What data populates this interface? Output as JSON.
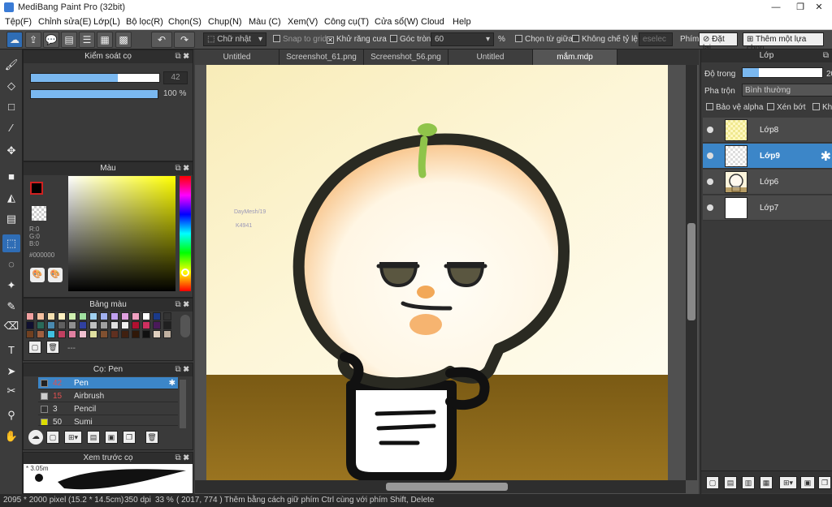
{
  "window": {
    "title": "MediBang Paint Pro (32bit)",
    "minimize": "—",
    "maximize": "❐",
    "close": "✕"
  },
  "menu": [
    "Tệp(F)",
    "Chỉnh sửa(E)",
    "Lớp(L)",
    "Bộ lọc(R)",
    "Chọn(S)",
    "Chụp(N)",
    "Màu (C)",
    "Xem(V)",
    "Công cụ(T)",
    "Cửa sổ(W)",
    "Cloud",
    "Help"
  ],
  "toolbar": {
    "shape": "Chữ nhật",
    "snap": "Snap to grid",
    "antialias": "Khử răng cưa",
    "round": "Góc tròn",
    "round_value": "60",
    "percent": "%",
    "center": "Chọn từ giữa",
    "ratio": "Không chế tỷ lệ",
    "deselect": "eselec",
    "key": "Phím",
    "reset": "Đặt lại",
    "add_selection": "Thêm một lựa chọn"
  },
  "brush_control": {
    "title": "Kiểm soát cọ",
    "size": "42",
    "opacity": "100 %",
    "size_fraction": 0.68,
    "opacity_fraction": 1.0
  },
  "color": {
    "title": "Màu",
    "r": "R:0",
    "g": "G:0",
    "b": "B:0",
    "hex": "#000000",
    "primary": "#000000",
    "hue_base": "#ffff00"
  },
  "palette": {
    "title": "Bảng màu",
    "colors": [
      "#f2a0a0",
      "#f5c0a0",
      "#f5e0b0",
      "#fff0c0",
      "#d0f0b0",
      "#a0e0a0",
      "#a0d0f0",
      "#a0b0f0",
      "#c0a0f0",
      "#e0a0e0",
      "#f0a0c0",
      "#ffffff",
      "#1a3a8a",
      "#333333",
      "#101030",
      "#2a6a5a",
      "#4a8ab0",
      "#606060",
      "#909090",
      "#3040a0",
      "#c0c0c0",
      "#a0a0a0",
      "#e0e0e0",
      "#f0f0f0",
      "#b01030",
      "#d03060",
      "#4a1a5a",
      "#202020",
      "#704020",
      "#a06040",
      "#40c0e0",
      "#c04060",
      "#e080a0",
      "#f0c0d0",
      "#e0e0a0",
      "#805030",
      "#603020",
      "#402010",
      "#301808",
      "#101010",
      "#e0d0c0",
      "#c0b0a0"
    ],
    "footer": "---"
  },
  "brushes": {
    "title": "Cọ: Pen",
    "items": [
      {
        "num": "42",
        "name": "Pen",
        "color": "#222222"
      },
      {
        "num": "15",
        "name": "Airbrush",
        "color": "#cccccc"
      },
      {
        "num": "3",
        "name": "Pencil",
        "color": "#333333"
      },
      {
        "num": "50",
        "name": "Sumi",
        "color": "#dddd00"
      }
    ]
  },
  "preview": {
    "title": "Xem trước cọ",
    "size": "* 3.05m"
  },
  "tabs": [
    "Untitled",
    "Screenshot_61.png",
    "Screenshot_56.png",
    "Untitled",
    "mắm.mdp"
  ],
  "layers_panel": {
    "title": "Lớp",
    "opacity_label": "Độ trong",
    "opacity_value": "20",
    "opacity_fraction": 0.2,
    "blend_label": "Pha trộn",
    "blend_value": "Bình thường",
    "protect_alpha": "Bảo vệ alpha",
    "clipping": "Xén bớt",
    "lock": "Khó",
    "layers": [
      {
        "name": "Lớp8",
        "selected": false
      },
      {
        "name": "Lớp9",
        "selected": true
      },
      {
        "name": "Lớp6",
        "selected": false
      },
      {
        "name": "Lớp7",
        "selected": false
      }
    ]
  },
  "canvas_text": {
    "signature_line1": "DayMesh/19",
    "signature_line2": "K4941"
  },
  "status": {
    "size": "2095 * 2000 pixel",
    "cm": "(15.2 * 14.5cm)",
    "dpi": "350 dpi",
    "zoom": "33 %",
    "coords": "( 2017, 774 )",
    "hint": "Thêm bằng cách giữ phím Ctrl cùng với phím Shift, Delete"
  }
}
